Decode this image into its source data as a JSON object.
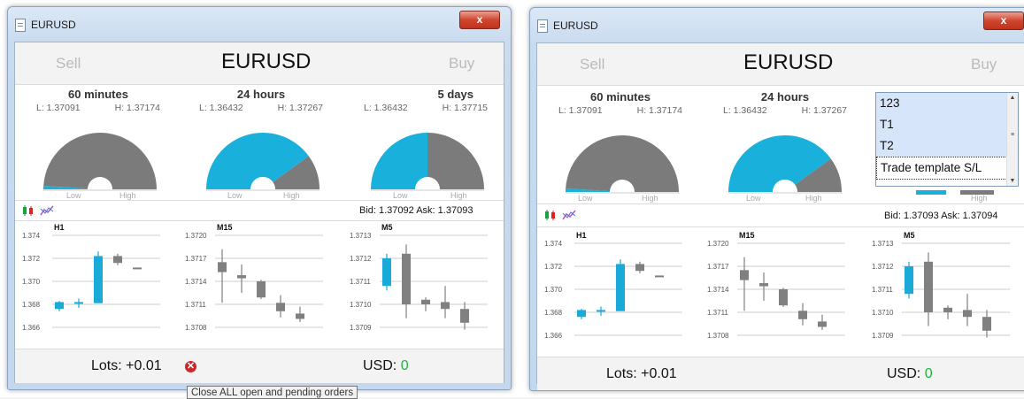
{
  "windows": [
    {
      "title": "EURUSD",
      "close_label": "x",
      "sell_label": "Sell",
      "pair": "EURUSD",
      "buy_label": "Buy",
      "periods": [
        {
          "name": "60 minutes",
          "low": "L: 1.37091",
          "high": "H: 1.37174",
          "level": 0.02
        },
        {
          "name": "24 hours",
          "low": "L: 1.36432",
          "high": "H: 1.37267",
          "level": 0.8
        },
        {
          "name": "5 days",
          "low": "L: 1.36432",
          "high": "H: 1.37715",
          "level": 0.5
        }
      ],
      "gauge_low": "Low",
      "gauge_high": "High",
      "bid_ask": "Bid: 1.37092   Ask: 1.37093",
      "lots": "Lots: +0.01",
      "usd_label": "USD:",
      "usd_value": "0"
    },
    {
      "title": "EURUSD",
      "close_label": "x",
      "sell_label": "Sell",
      "pair": "EURUSD",
      "buy_label": "Buy",
      "periods": [
        {
          "name": "60 minutes",
          "low": "L: 1.37091",
          "high": "H: 1.37174",
          "level": 0.02
        },
        {
          "name": "24 hours",
          "low": "L: 1.36432",
          "high": "H: 1.37267",
          "level": 0.8
        }
      ],
      "gauge_low": "Low",
      "gauge_high": "High",
      "bid_ask": "Bid: 1.37093   Ask: 1.37094",
      "lots": "Lots: +0.01",
      "usd_label": "USD:",
      "usd_value": "0",
      "dropdown": [
        "123",
        "T1",
        "T2",
        "Trade template S/L"
      ]
    }
  ],
  "tooltip": "Close ALL open and pending orders",
  "colors": {
    "up": "#1aaad8",
    "down": "#808080",
    "gauge_fill": "#1ab0dc",
    "gauge_empty": "#7b7b7b"
  },
  "chart_data": [
    {
      "type": "candlestick",
      "title": "H1",
      "ylim": [
        1.366,
        1.374
      ],
      "y_ticks": [
        "1.374",
        "1.372",
        "1.370",
        "1.368",
        "1.366"
      ],
      "candles": [
        {
          "o": 1.3676,
          "h": 1.3683,
          "l": 1.3674,
          "c": 1.3682
        },
        {
          "o": 1.3681,
          "h": 1.3685,
          "l": 1.3677,
          "c": 1.3682
        },
        {
          "o": 1.3681,
          "h": 1.3726,
          "l": 1.3681,
          "c": 1.3722
        },
        {
          "o": 1.3722,
          "h": 1.3724,
          "l": 1.3714,
          "c": 1.3716
        },
        {
          "o": 1.3712,
          "h": 1.3712,
          "l": 1.3711,
          "c": 1.3711
        }
      ]
    },
    {
      "type": "candlestick",
      "title": "M15",
      "ylim": [
        1.3708,
        1.372
      ],
      "y_ticks": [
        "1.3720",
        "1.3717",
        "1.3714",
        "1.3711",
        "1.3708"
      ],
      "candles": [
        {
          "o": 1.37165,
          "h": 1.37182,
          "l": 1.37112,
          "c": 1.37152
        },
        {
          "o": 1.37148,
          "h": 1.37162,
          "l": 1.37125,
          "c": 1.37144
        },
        {
          "o": 1.3714,
          "h": 1.37142,
          "l": 1.37117,
          "c": 1.37119
        },
        {
          "o": 1.37112,
          "h": 1.37122,
          "l": 1.37093,
          "c": 1.37101
        },
        {
          "o": 1.37098,
          "h": 1.37107,
          "l": 1.37087,
          "c": 1.37091
        }
      ]
    },
    {
      "type": "candlestick",
      "title": "M5",
      "ylim": [
        1.3709,
        1.3713
      ],
      "y_ticks": [
        "1.3713",
        "1.3712",
        "1.3711",
        "1.3710",
        "1.3709"
      ],
      "candles": [
        {
          "o": 1.37108,
          "h": 1.37122,
          "l": 1.37106,
          "c": 1.3712
        },
        {
          "o": 1.37122,
          "h": 1.37126,
          "l": 1.37094,
          "c": 1.371
        },
        {
          "o": 1.37102,
          "h": 1.37103,
          "l": 1.37097,
          "c": 1.371
        },
        {
          "o": 1.37101,
          "h": 1.37108,
          "l": 1.37094,
          "c": 1.37098
        },
        {
          "o": 1.37098,
          "h": 1.37101,
          "l": 1.37089,
          "c": 1.37092
        }
      ]
    }
  ]
}
